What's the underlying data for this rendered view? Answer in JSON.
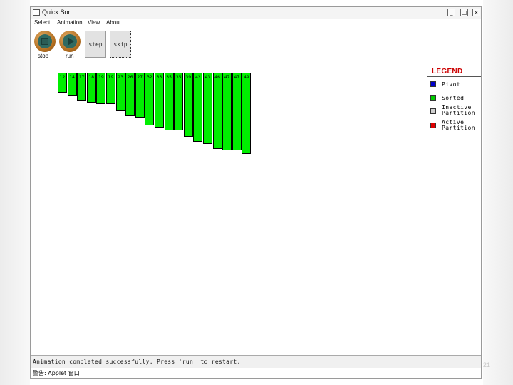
{
  "window": {
    "title": "Quick Sort",
    "controls": [
      "_",
      "□",
      "×"
    ]
  },
  "menu": [
    "Select",
    "Animation",
    "View",
    "About"
  ],
  "toolbar": {
    "stop_label": "stop",
    "run_label": "run",
    "step_label": "step",
    "skip_label": "skip"
  },
  "chart_data": {
    "type": "bar",
    "values": [
      12,
      14,
      17,
      18,
      19,
      19,
      23,
      26,
      27,
      32,
      33,
      35,
      35,
      39,
      42,
      43,
      46,
      47,
      47,
      49
    ],
    "state": "sorted"
  },
  "legend": {
    "title": "LEGEND",
    "items": [
      {
        "label": "Pivot",
        "color": "#0000cc"
      },
      {
        "label": "Sorted",
        "color": "#00cc00"
      },
      {
        "label": "Inactive Partition",
        "color": "#d0d0d0"
      },
      {
        "label": "Active Partition",
        "color": "#dd0000"
      }
    ]
  },
  "status": {
    "message": "Animation completed successfully.  Press 'run' to restart."
  },
  "warning": {
    "text": "警告: Applet 窗口"
  },
  "page_number": "21"
}
